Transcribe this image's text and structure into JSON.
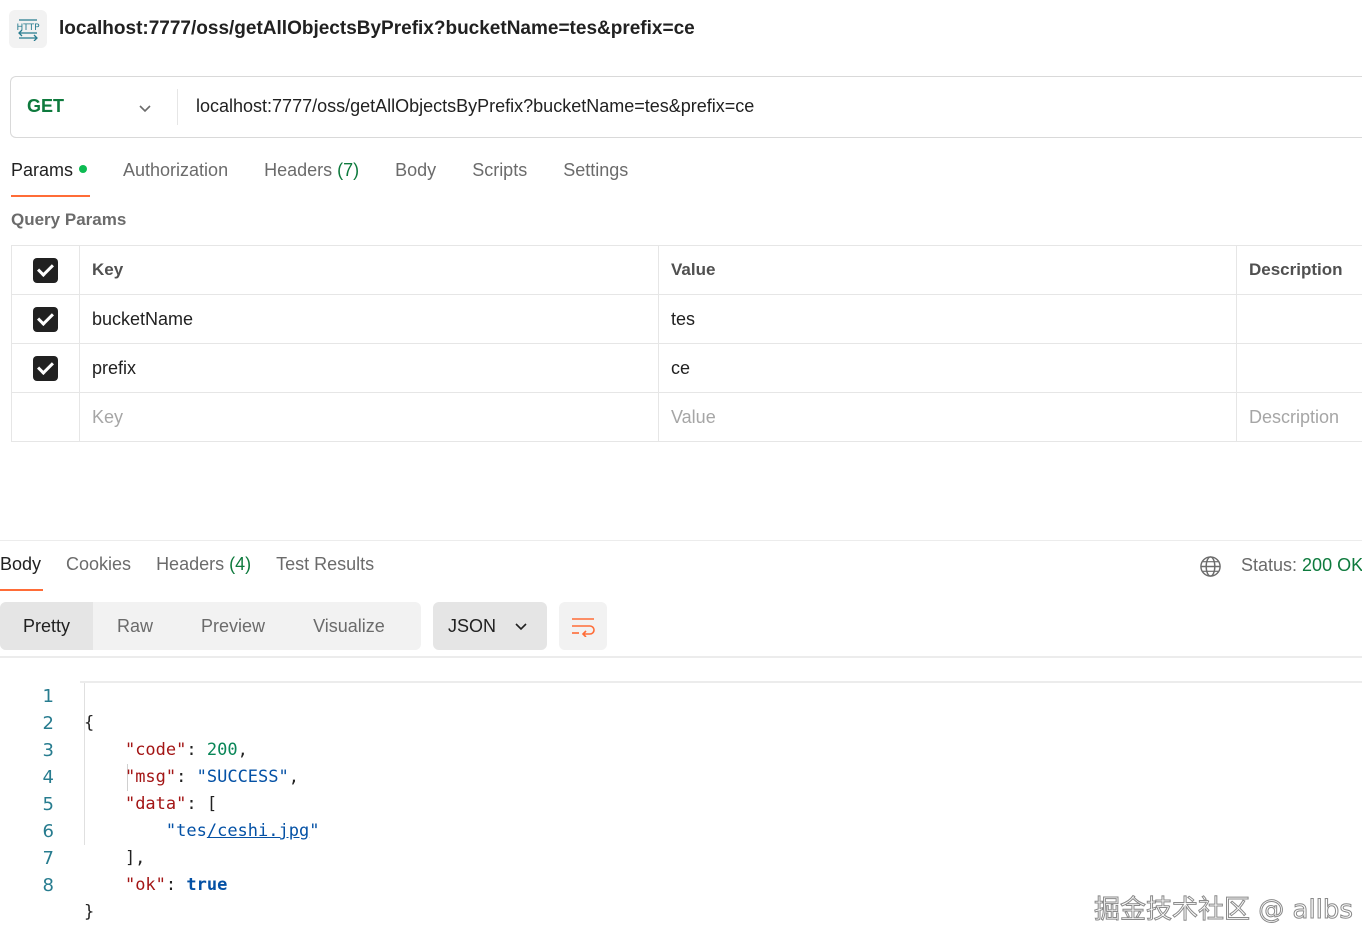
{
  "request": {
    "title": "localhost:7777/oss/getAllObjectsByPrefix?bucketName=tes&prefix=ce",
    "method": "GET",
    "url": "localhost:7777/oss/getAllObjectsByPrefix?bucketName=tes&prefix=ce"
  },
  "request_tabs": {
    "params": "Params",
    "authorization": "Authorization",
    "headers": "Headers",
    "headers_count": "(7)",
    "body": "Body",
    "scripts": "Scripts",
    "settings": "Settings"
  },
  "query_params": {
    "label": "Query Params",
    "columns": {
      "key": "Key",
      "value": "Value",
      "description": "Description"
    },
    "rows": [
      {
        "key": "bucketName",
        "value": "tes",
        "description": ""
      },
      {
        "key": "prefix",
        "value": "ce",
        "description": ""
      }
    ],
    "placeholders": {
      "key": "Key",
      "value": "Value",
      "description": "Description"
    }
  },
  "response_tabs": {
    "body": "Body",
    "cookies": "Cookies",
    "headers": "Headers",
    "headers_count": "(4)",
    "test_results": "Test Results"
  },
  "status": {
    "label": "Status:",
    "value": "200 OK"
  },
  "view_modes": {
    "pretty": "Pretty",
    "raw": "Raw",
    "preview": "Preview",
    "visualize": "Visualize"
  },
  "format": "JSON",
  "code": {
    "line_numbers": [
      "1",
      "2",
      "3",
      "4",
      "5",
      "6",
      "7",
      "8"
    ],
    "open_brace": "{",
    "close_brace": "}",
    "code_key": "\"code\"",
    "code_value": "200",
    "msg_key": "\"msg\"",
    "msg_value": "\"SUCCESS\"",
    "data_key": "\"data\"",
    "data_item_prefix": "\"tes",
    "data_item_link": "/ceshi.jpg",
    "data_item_suffix": "\"",
    "ok_key": "\"ok\"",
    "ok_value": "true"
  },
  "watermark": "掘金技术社区 @ allbs",
  "colors": {
    "accent": "#ff6c37",
    "method_green": "#0e7a3d",
    "dot_green": "#0cbb52"
  },
  "icons": {
    "request_type": "http-icon",
    "globe": "globe-icon",
    "wrap": "wrap-lines-icon"
  }
}
